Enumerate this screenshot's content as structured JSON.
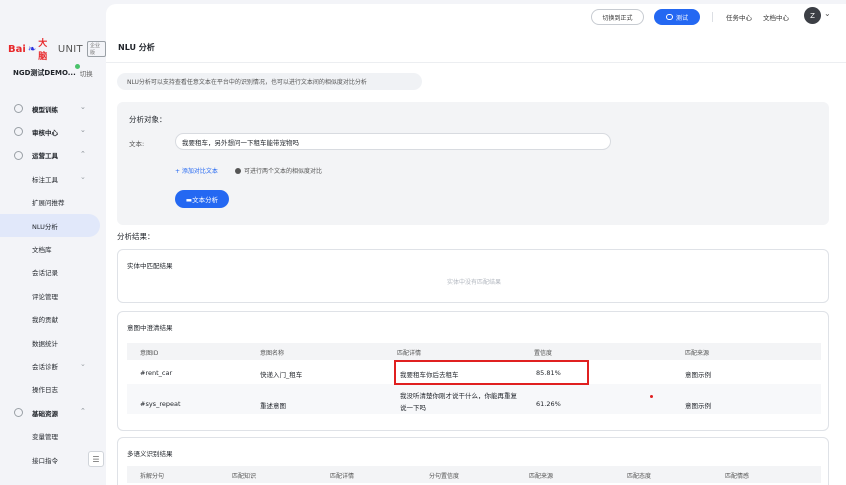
{
  "sidebar": {
    "logo": {
      "bai": "Bai",
      "paw": "❧",
      "dn": "大脑",
      "unit": "UNIT",
      "badge": "企业版"
    },
    "project": {
      "name": "NGD测试DEMO...",
      "switch_label": "切换"
    },
    "nav": [
      {
        "label": "模型训练",
        "type": "group",
        "chev": "⌄"
      },
      {
        "label": "审核中心",
        "type": "group",
        "chev": "⌄"
      },
      {
        "label": "运营工具",
        "type": "group",
        "chev": "⌃"
      },
      {
        "label": "标注工具",
        "type": "sub",
        "chev": "⌄"
      },
      {
        "label": "扩展问推荐",
        "type": "sub"
      },
      {
        "label": "NLU分析",
        "type": "sub",
        "active": true
      },
      {
        "label": "文档库",
        "type": "sub"
      },
      {
        "label": "会话记录",
        "type": "sub"
      },
      {
        "label": "评论管理",
        "type": "sub"
      },
      {
        "label": "我的贡献",
        "type": "sub"
      },
      {
        "label": "数据统计",
        "type": "sub"
      },
      {
        "label": "会话诊断",
        "type": "sub",
        "chev": "⌄"
      },
      {
        "label": "操作日志",
        "type": "sub"
      },
      {
        "label": "基础资源",
        "type": "group",
        "chev": "⌃"
      },
      {
        "label": "变量管理",
        "type": "sub"
      },
      {
        "label": "接口指令",
        "type": "sub"
      }
    ],
    "collapse_icon": "☰"
  },
  "topbar": {
    "switch_formal": "切换到正式",
    "test": "测试",
    "task_center": "任务中心",
    "doc_center": "文档中心",
    "avatar": "Z",
    "avatar_chev": "⌄"
  },
  "page": {
    "title": "NLU 分析",
    "info": "NLU分析可以支持查看任意文本在平台中的识别情况，也可以进行文本间的相似度对比分析"
  },
  "analysis": {
    "title": "分析对象：",
    "text_label": "文本:",
    "text_value": "我要租车，另外想问一下租车能带宠物吗",
    "add_compare": "+ 添加对比文本",
    "hint": "可进行两个文本的相似度对比",
    "button": "▬文本分析"
  },
  "results": {
    "title": "分析结果：",
    "entity": {
      "title": "实体中匹配结果",
      "empty": "实体中没有匹配结果"
    },
    "intent": {
      "title": "意图中澄清结果",
      "columns": [
        "意图ID",
        "意图名称",
        "匹配详情",
        "置信度",
        "匹配来源"
      ],
      "rows": [
        [
          "#rent_car",
          "快递入门_租车",
          "我要租车你后去租车",
          "85.81%",
          "意图示例"
        ],
        [
          "#sys_repeat",
          "重述意图",
          "我没听清楚你刚才说干什么，你能再重复说一下吗",
          "61.26%",
          "意图示例"
        ]
      ]
    },
    "multi": {
      "title": "多语义识别结果",
      "columns": [
        "拆解分句",
        "匹配知识",
        "匹配详情",
        "分句置信度",
        "匹配来源",
        "匹配态度",
        "匹配情感"
      ]
    }
  },
  "colors": {
    "primary": "#2468f2",
    "highlight": "#e02020",
    "active_nav": "#e1e8fa"
  }
}
